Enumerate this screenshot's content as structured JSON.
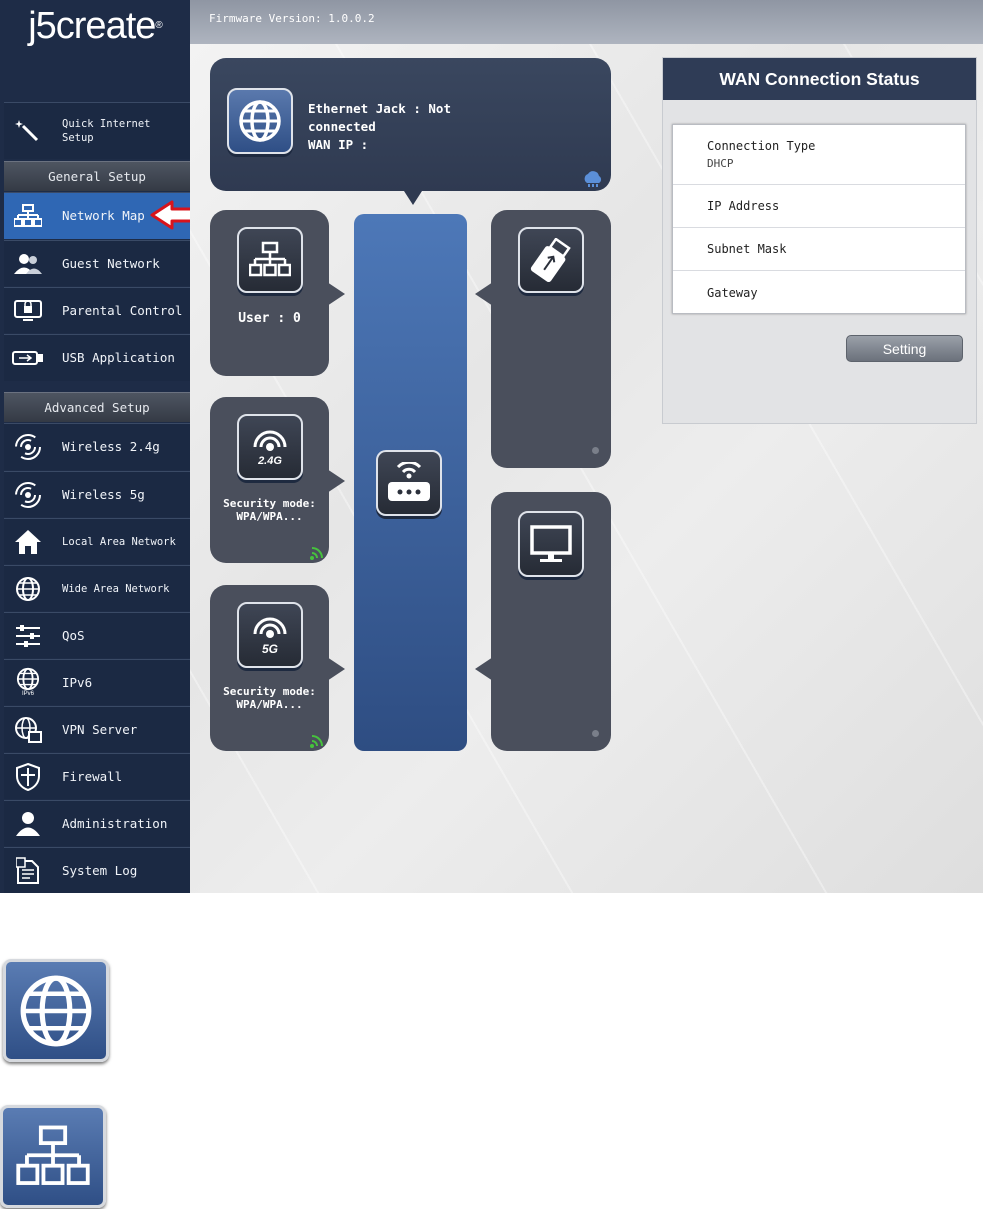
{
  "brand": {
    "logo_text": "j5create",
    "logo_mark": "®"
  },
  "header": {
    "firmware": "Firmware Version: 1.0.0.2"
  },
  "sidebar": {
    "quick": {
      "label_line1": "Quick Internet",
      "label_line2": "Setup",
      "icon": "magic-wand-icon"
    },
    "general_setup_title": "General Setup",
    "general_items": [
      {
        "label": "Network Map",
        "icon": "network-map-icon",
        "active": true
      },
      {
        "label": "Guest Network",
        "icon": "guests-icon"
      },
      {
        "label": "Parental Control",
        "icon": "parental-control-icon"
      },
      {
        "label": "USB Application",
        "icon": "usb-icon"
      }
    ],
    "advanced_setup_title": "Advanced Setup",
    "advanced_items": [
      {
        "label": "Wireless 2.4g",
        "icon": "wifi-icon"
      },
      {
        "label": "Wireless 5g",
        "icon": "wifi-icon"
      },
      {
        "label": "Local Area Network",
        "icon": "home-icon"
      },
      {
        "label": "Wide Area Network",
        "icon": "globe-icon"
      },
      {
        "label": "QoS",
        "icon": "sliders-icon"
      },
      {
        "label": "IPv6",
        "icon": "ipv6-globe-icon",
        "sublabel": "IPv6"
      },
      {
        "label": "VPN Server",
        "icon": "vpn-icon"
      },
      {
        "label": "Firewall",
        "icon": "shield-icon"
      },
      {
        "label": "Administration",
        "icon": "user-icon"
      },
      {
        "label": "System Log",
        "icon": "log-icon"
      }
    ]
  },
  "network_map": {
    "internet": {
      "line1": "Ethernet Jack : Not",
      "line2": "connected",
      "line3": "WAN IP :"
    },
    "clients": {
      "label": "User : 0"
    },
    "wifi24": {
      "badge": "2.4G",
      "line1": "Security mode:",
      "line2": "WPA/WPA..."
    },
    "wifi5": {
      "badge": "5G",
      "line1": "Security mode:",
      "line2": "WPA/WPA..."
    }
  },
  "wan_status": {
    "title": "WAN Connection Status",
    "rows": [
      {
        "key": "Connection Type",
        "value": "DHCP"
      },
      {
        "key": "IP Address",
        "value": ""
      },
      {
        "key": "Subnet Mask",
        "value": ""
      },
      {
        "key": "Gateway",
        "value": ""
      }
    ],
    "button": "Setting"
  },
  "colors": {
    "sidebar_bg": "#1e2c47",
    "active_item": "#2f67b4",
    "router_blue": "#3d63a3",
    "pointer_red": "#d8141b"
  }
}
